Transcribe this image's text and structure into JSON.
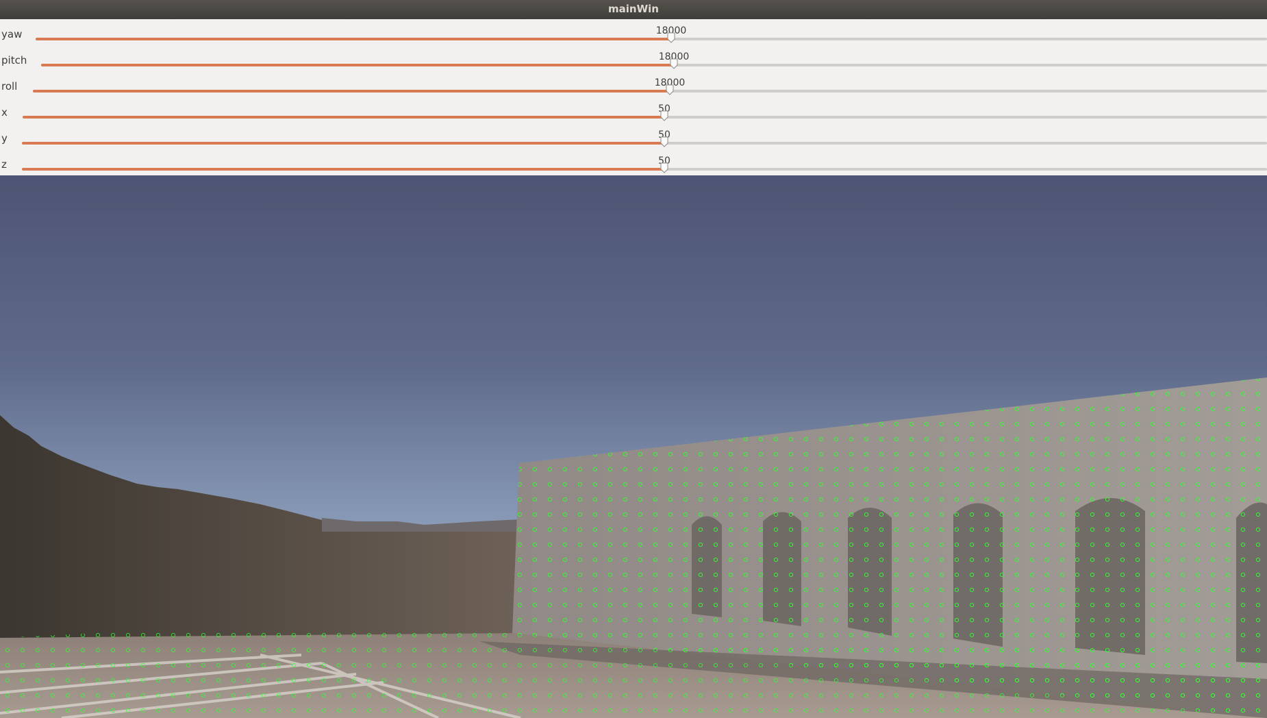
{
  "window": {
    "title": "mainWin"
  },
  "sliders": [
    {
      "name": "yaw",
      "value": "18000",
      "fraction": 0.5
    },
    {
      "name": "pitch",
      "value": "18000",
      "fraction": 0.5
    },
    {
      "name": "roll",
      "value": "18000",
      "fraction": 0.5
    },
    {
      "name": "x",
      "value": "50",
      "fraction": 0.5
    },
    {
      "name": "y",
      "value": "50",
      "fraction": 0.5
    },
    {
      "name": "z",
      "value": "50",
      "fraction": 0.5
    }
  ],
  "colors": {
    "accent": "#d97b52",
    "track": "#cfcdc9",
    "markers": "#33ff33"
  }
}
